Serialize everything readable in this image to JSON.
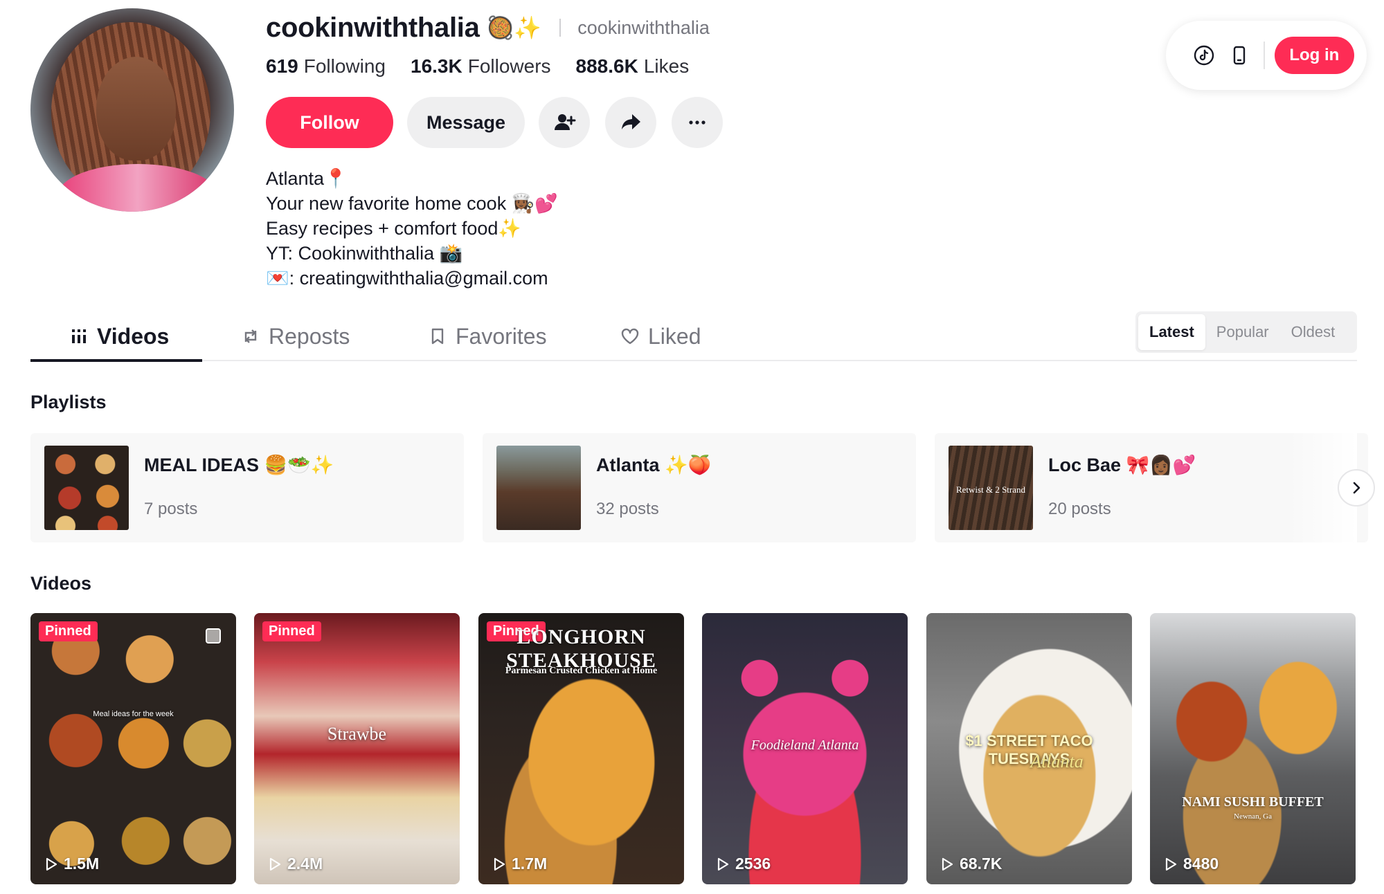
{
  "top_bar": {
    "tiktok_icon": "tiktok-logo-icon",
    "phone_icon": "mobile-phone-icon",
    "login_label": "Log in"
  },
  "profile": {
    "display_name": "cookinwiththalia",
    "name_emoji": "🥘✨",
    "username": "cookinwiththalia",
    "stats": [
      {
        "number": "619",
        "label": "Following"
      },
      {
        "number": "16.3K",
        "label": "Followers"
      },
      {
        "number": "888.6K",
        "label": "Likes"
      }
    ],
    "follow_label": "Follow",
    "message_label": "Message",
    "bio": [
      "Atlanta📍",
      "Your new favorite home cook 👩🏾‍🍳💕",
      "Easy recipes + comfort food✨",
      "YT: Cookinwiththalia 📸",
      "💌: creatingwiththalia@gmail.com"
    ]
  },
  "tabs": [
    {
      "label": "Videos",
      "icon": "grid-icon",
      "active": true
    },
    {
      "label": "Reposts",
      "icon": "repost-icon",
      "active": false
    },
    {
      "label": "Favorites",
      "icon": "bookmark-icon",
      "active": false
    },
    {
      "label": "Liked",
      "icon": "heart-icon",
      "active": false
    }
  ],
  "sort": {
    "options": [
      "Latest",
      "Popular",
      "Oldest"
    ],
    "selected": "Latest"
  },
  "playlists_title": "Playlists",
  "playlists": [
    {
      "title": "MEAL IDEAS 🍔🥗✨",
      "count": "7 posts",
      "thumb_text": ""
    },
    {
      "title": "Atlanta ✨🍑",
      "count": "32 posts",
      "thumb_text": ""
    },
    {
      "title": "Loc Bae 🎀👩🏾💕",
      "count": "20 posts",
      "thumb_text": "Retwist & 2 Strand"
    }
  ],
  "videos_title": "Videos",
  "videos": [
    {
      "pinned_label": "Pinned",
      "views": "1.5M",
      "caption": "Meal ideas for the week"
    },
    {
      "pinned_label": "Pinned",
      "views": "2.4M",
      "caption": "Strawbe"
    },
    {
      "pinned_label": "Pinned",
      "views": "1.7M",
      "caption": "LONGHORN STEAKHOUSE",
      "subcaption": "Parmesan Crusted Chicken at Home"
    },
    {
      "pinned_label": "",
      "views": "2536",
      "caption": "Foodieland Atlanta"
    },
    {
      "pinned_label": "",
      "views": "68.7K",
      "caption": "$1 STREET TACO TUESDAYS",
      "subcaption": "Atlanta"
    },
    {
      "pinned_label": "",
      "views": "8480",
      "caption": "NAMI SUSHI BUFFET",
      "subcaption": "Newnan, Ga"
    }
  ],
  "colors": {
    "accent": "#fe2c55",
    "text": "#161823",
    "muted": "#75767e"
  }
}
